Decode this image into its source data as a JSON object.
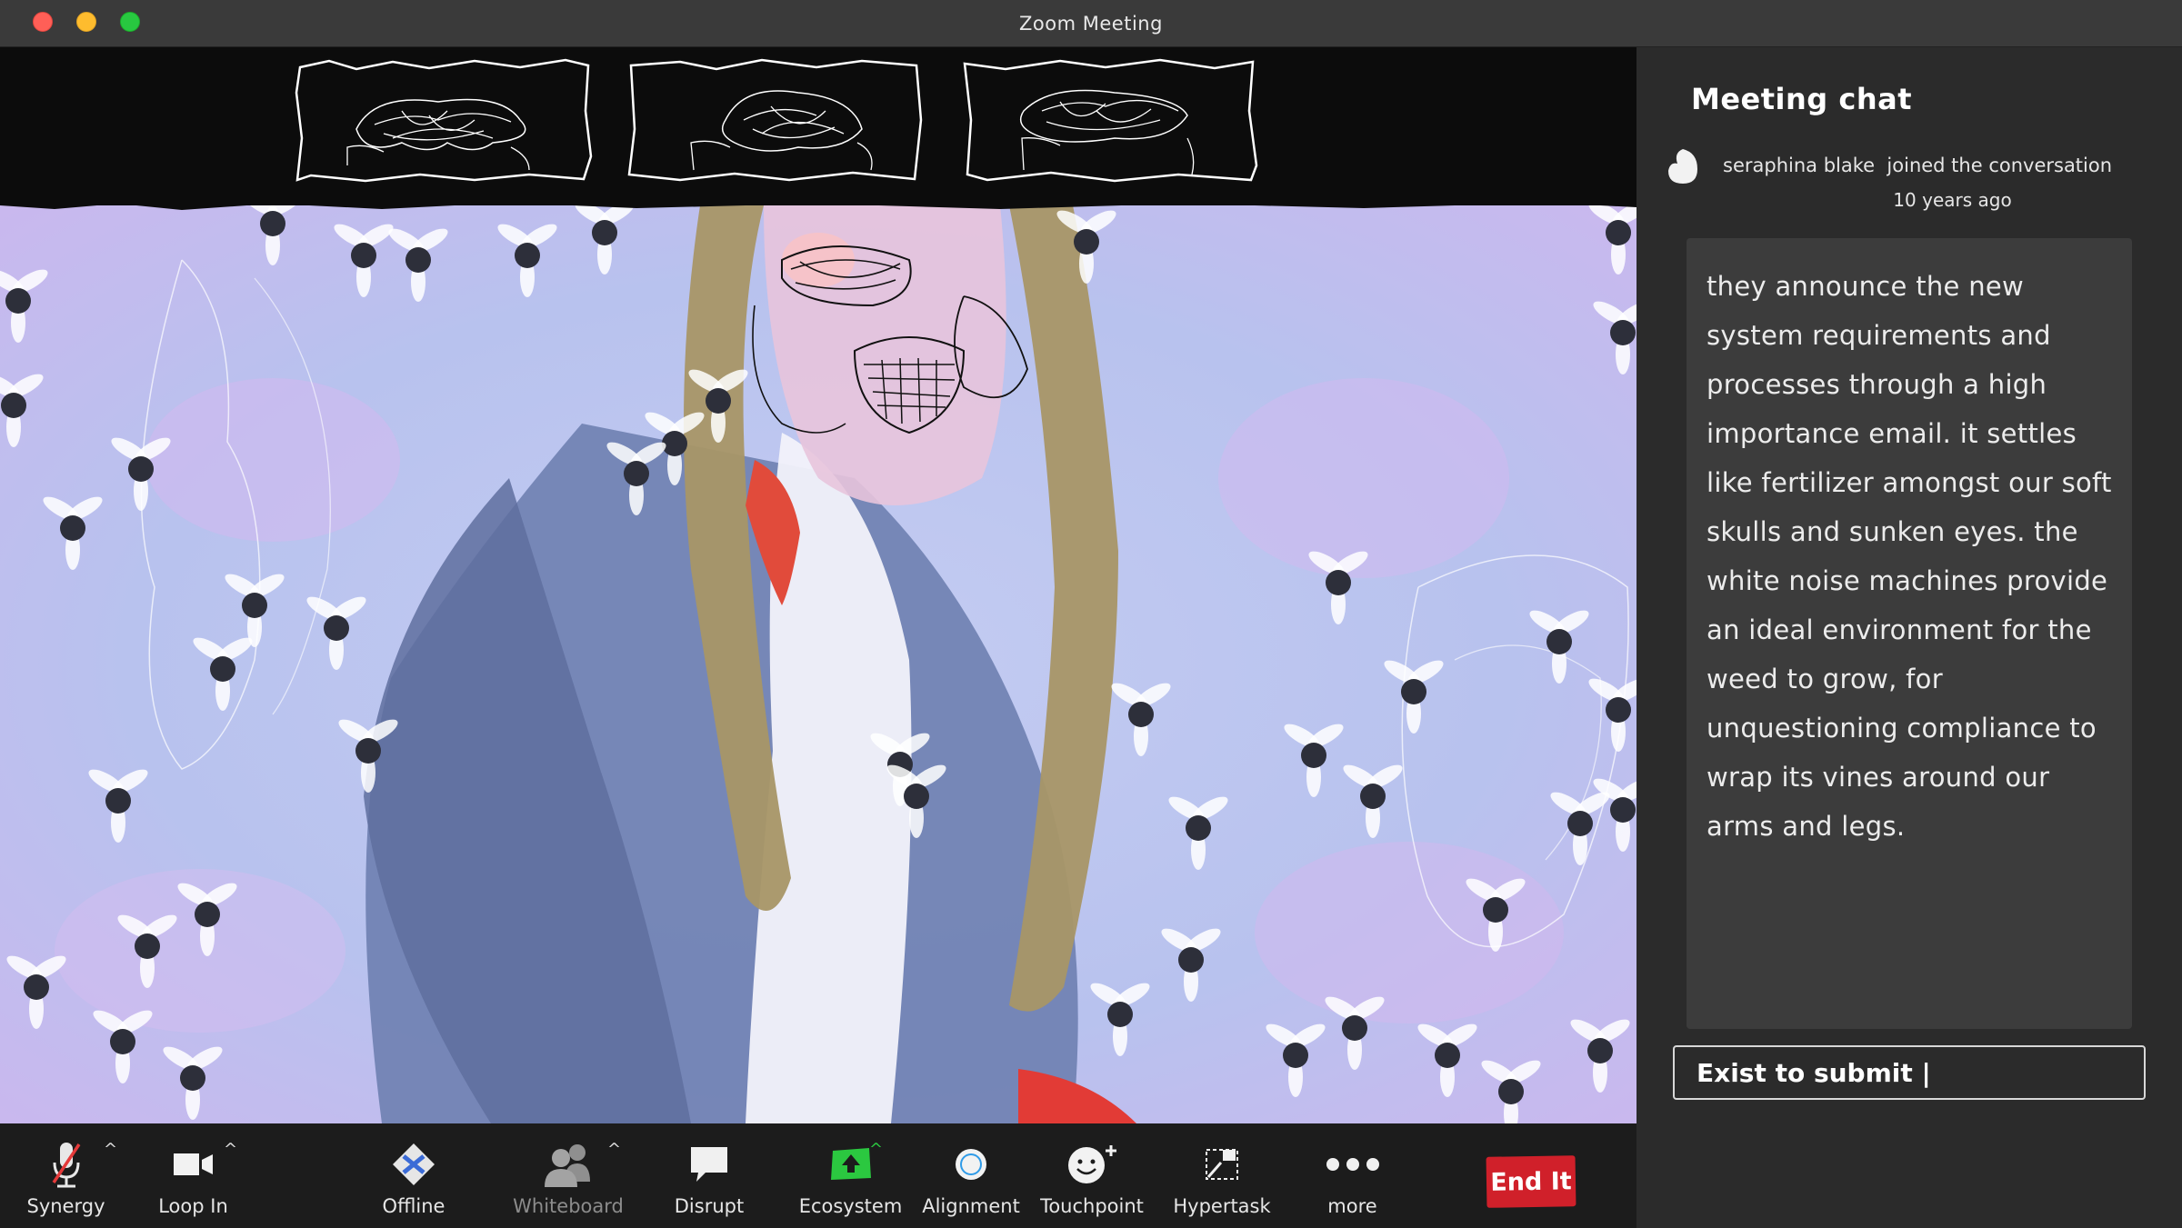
{
  "window": {
    "title": "Zoom Meeting"
  },
  "participants_strip": {
    "thumbnails": [
      {
        "id": "participant-1"
      },
      {
        "id": "participant-2"
      },
      {
        "id": "participant-3"
      }
    ]
  },
  "toolbar": {
    "buttons": [
      {
        "label": "Synergy",
        "icon": "microphone-muted-icon",
        "has_caret": true
      },
      {
        "label": "Loop In",
        "icon": "video-camera-icon",
        "has_caret": true
      },
      {
        "label": "Offline",
        "icon": "diamond-hourglass-icon",
        "has_caret": false
      },
      {
        "label": "Whiteboard",
        "icon": "participants-icon",
        "has_caret": true,
        "dimmed": true
      },
      {
        "label": "Disrupt",
        "icon": "speech-bubble-icon",
        "has_caret": false
      },
      {
        "label": "Ecosystem",
        "icon": "share-screen-icon",
        "has_caret": true
      },
      {
        "label": "Alignment",
        "icon": "record-circle-icon",
        "has_caret": false
      },
      {
        "label": "Touchpoint",
        "icon": "smiley-add-icon",
        "has_caret": false
      },
      {
        "label": "Hypertask",
        "icon": "apps-icon",
        "has_caret": false
      },
      {
        "label": "more",
        "icon": "more-dots-icon",
        "has_caret": false
      }
    ],
    "end_label": "End It"
  },
  "chat": {
    "title": "Meeting chat",
    "join_event": {
      "name": "seraphina blake",
      "text": "joined the conversation",
      "time": "10 years ago"
    },
    "message": "they announce the new system requirements and processes through a high importance email. it settles like fertilizer amongst our soft skulls and sunken eyes. the white noise machines provide an ideal environment for the weed to grow, for unquestioning compliance to wrap its vines around our arms and legs.",
    "input_placeholder": "Exist to submit |"
  },
  "colors": {
    "end_button": "#d0202a",
    "ecosystem_icon": "#2bc840",
    "background_lavender": "#b8c4ee"
  }
}
